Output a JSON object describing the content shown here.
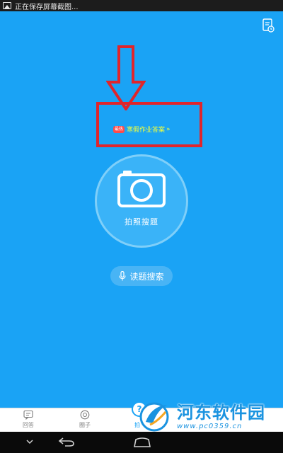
{
  "status_bar": {
    "notification_text": "正在保存屏幕截图...",
    "icon": "image-icon"
  },
  "header": {
    "history_icon": "history-doc-icon"
  },
  "promo": {
    "tag": "最热",
    "text": "寒假作业答案",
    "chevron": "»",
    "text_color": "#f3ff3a"
  },
  "camera": {
    "label": "拍照搜题",
    "icon": "camera-icon"
  },
  "voice": {
    "label": "读题搜索",
    "icon": "microphone-icon"
  },
  "bottom_nav": {
    "items": [
      {
        "label": "回答",
        "icon": "chat-icon"
      },
      {
        "label": "圈子",
        "icon": "circle-icon"
      },
      {
        "label": "拍",
        "icon": "question-icon"
      }
    ]
  },
  "watermark": {
    "title": "河东软件园",
    "url": "www.pc0359.cn"
  },
  "colors": {
    "background": "#1aa3f5",
    "annotation_red": "#e0252b"
  }
}
